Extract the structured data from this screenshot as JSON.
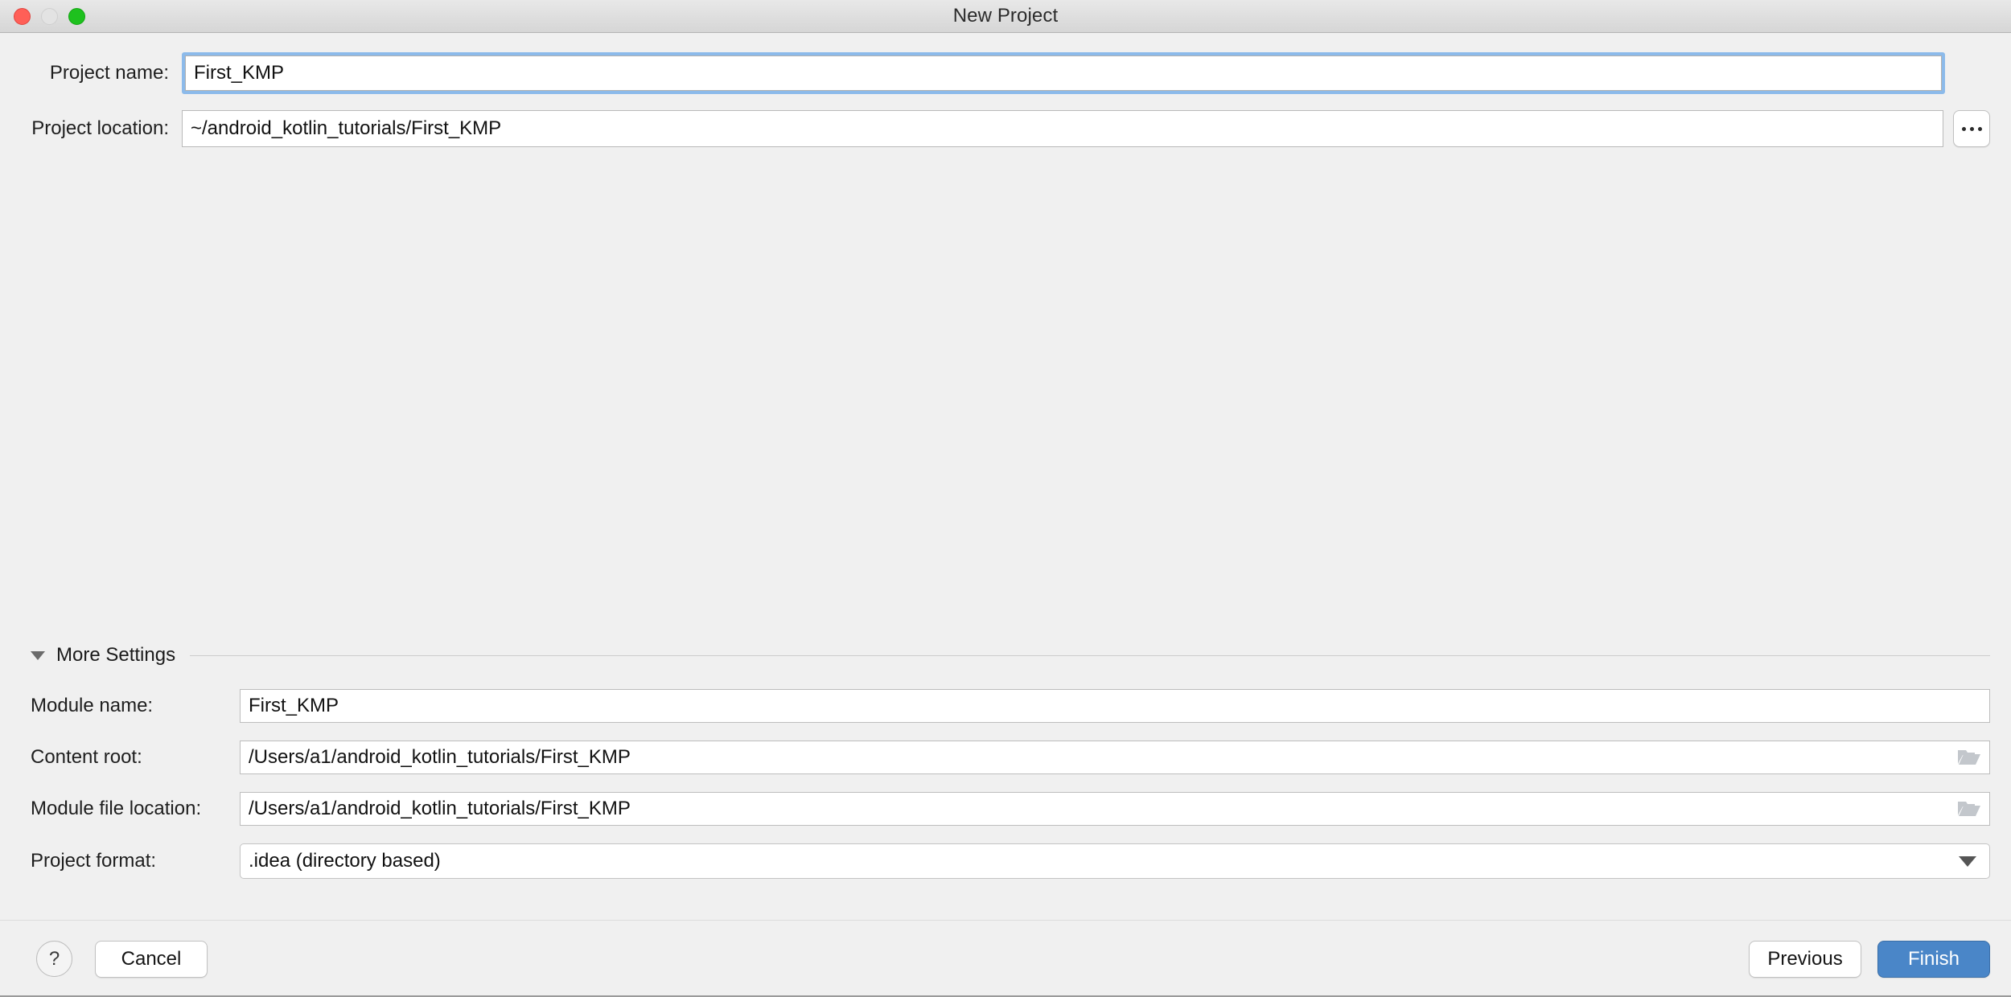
{
  "window": {
    "title": "New Project",
    "traffic_lights": [
      "close-button",
      "minimize-button",
      "maximize-button"
    ]
  },
  "top_form": {
    "project_name": {
      "label": "Project name:",
      "value": "First_KMP",
      "focused": true
    },
    "project_location": {
      "label": "Project location:",
      "value": "~/android_kotlin_tutorials/First_KMP",
      "browse_label": "..."
    }
  },
  "more_settings": {
    "title": "More Settings",
    "expanded": true,
    "fields": [
      {
        "label": "Module name:",
        "value": "First_KMP",
        "type": "text"
      },
      {
        "label": "Content root:",
        "value": "/Users/a1/android_kotlin_tutorials/First_KMP",
        "type": "path"
      },
      {
        "label": "Module file location:",
        "value": "/Users/a1/android_kotlin_tutorials/First_KMP",
        "type": "path"
      },
      {
        "label": "Project format:",
        "value": ".idea (directory based)",
        "type": "combo"
      }
    ]
  },
  "footer": {
    "help_label": "?",
    "cancel_label": "Cancel",
    "previous_label": "Previous",
    "finish_label": "Finish"
  },
  "colors": {
    "accent": "#4a86c8",
    "focus_ring": "#8cbaea",
    "background": "#f0f0f0",
    "close": "#ff5f57",
    "maximize": "#1ec11e"
  }
}
